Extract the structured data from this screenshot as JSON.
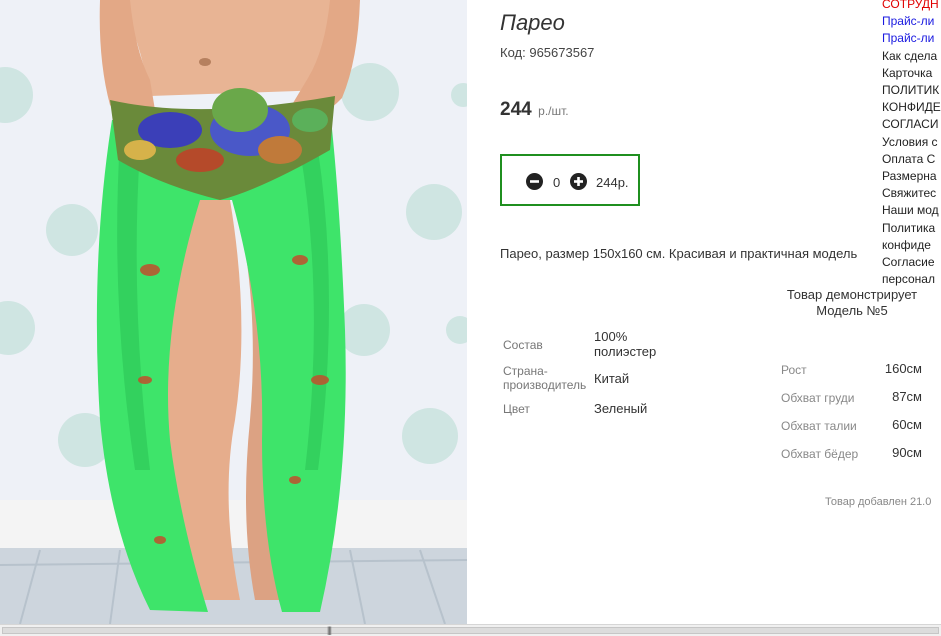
{
  "product": {
    "title": "Парео",
    "code_label": "Код:",
    "code_value": "965673567",
    "price_value": "244",
    "price_unit": "р./шт.",
    "quantity": "0",
    "total": "244р.",
    "description": "Парео, размер 150х160 см. Красивая и практичная модель"
  },
  "attributes": [
    {
      "label": "Состав",
      "value": "100% полиэстер"
    },
    {
      "label": "Страна-производитель",
      "value": "Китай"
    },
    {
      "label": "Цвет",
      "value": "Зеленый"
    }
  ],
  "model": {
    "caption": "Товар демонстрирует Модель №5",
    "rows": [
      {
        "label": "Рост",
        "value": "160см"
      },
      {
        "label": "Обхват груди",
        "value": "87см"
      },
      {
        "label": "Обхват талии",
        "value": "60см"
      },
      {
        "label": "Обхват бёдер",
        "value": "90см"
      }
    ]
  },
  "added_date": "Товар добавлен 21.0",
  "side_menu": [
    {
      "label": "СОТРУДН",
      "color": "#e00000"
    },
    {
      "label": "Прайс-ли",
      "color": "#1a1ae0"
    },
    {
      "label": "Прайс-ли",
      "color": "#1a1ae0"
    },
    {
      "label": "Как сдела",
      "color": "#222222"
    },
    {
      "label": "Карточка",
      "color": "#222222"
    },
    {
      "label": "ПОЛИТИК",
      "color": "#222222"
    },
    {
      "label": "КОНФИДЕ",
      "color": "#222222"
    },
    {
      "label": "СОГЛАСИ",
      "color": "#222222"
    },
    {
      "label": "Условия с",
      "color": "#222222"
    },
    {
      "label": "Оплата С",
      "color": "#222222"
    },
    {
      "label": "Размерна",
      "color": "#222222"
    },
    {
      "label": "Свяжитес",
      "color": "#222222"
    },
    {
      "label": "Наши мод",
      "color": "#222222"
    },
    {
      "label": "Политика",
      "color": "#222222"
    },
    {
      "label": "конфиде",
      "color": "#222222"
    },
    {
      "label": "Согласие",
      "color": "#222222"
    },
    {
      "label": "персонал",
      "color": "#222222"
    }
  ],
  "colors": {
    "quantity_border": "#1f8f1f",
    "pareo_green": "#3ee46a"
  },
  "icons": {
    "minus": "minus-circle-icon",
    "plus": "plus-circle-icon"
  }
}
